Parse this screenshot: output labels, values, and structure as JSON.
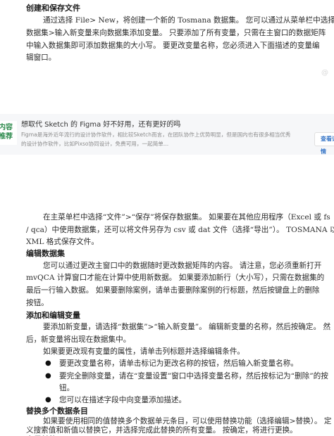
{
  "section1": {
    "heading": "创建和保存文件",
    "lines": [
      "通过选择 File> New，将创建一个新的 Tosmana 数据集。 您可以通过从菜单栏中选择",
      "数据集>输入新变量来向数据集添加变量。 只要添加了所有变量，只需在主窗口的数据矩阵",
      "中输入数据集即可添加数据集的大小写。 要更改变量名称，您必须进入下面描述的变量编",
      "辑窗口。"
    ]
  },
  "watermark": "@",
  "ad": {
    "badge_lines": [
      "内容",
      "推荐"
    ],
    "title": "想取代 Sketch 的 Figma 好不好用，还有更好的吗",
    "tag": "广告",
    "desc_lines": [
      "Figma是海外近年流行的设计协作软件，相比较Sketch而言，在团队协作上优势明显，但是国内也有很多相当优秀",
      "的设计协作软件，比如Pixso协同设计，免费可用，一起简单..."
    ],
    "button": "查看详情"
  },
  "section2": {
    "lines": [
      "在主菜单栏中选择“文件”>“保存”将保存数据集。 如果要在其他应用程序（Excel 或 fs",
      "/ qca）中使用数据集，还可以将文件另存为 csv 或 dat 文件（选择“导出”）。 TOSMANA 以",
      "XML 格式保存文件。"
    ]
  },
  "section3": {
    "heading": "编辑数据集",
    "lines": [
      "您可以通过更改主窗口中的数据随时更改数据矩阵的内容。 请注意，您必须重新打开",
      "mvQCA 计算窗口才能在计算中使用新数据。 如果要添加新行（大小写），只需在数据集的",
      "最后一行输入数据。 如果要删除案例，请单击要删除案例的行标题，然后按键盘上的删除",
      "按钮。"
    ]
  },
  "section4": {
    "heading": "添加和编辑变量",
    "lines": [
      "要添加新变量，请选择“数据集”>“输入新变量”。 编辑新变量的名称，然后按确定。 然",
      "后，新变量将出现在数据集中。",
      "如果要更改现有变量的属性，请单击列标题并选择编辑条件。"
    ],
    "bullets": [
      [
        "要更改变量名称，请单击标记为更改名称的按钮，然后输入新变量名称。"
      ],
      [
        "要完全删除变量，请在“变量设置”窗口中选择变量名称，然后按标记为“删除”的按",
        "钮。"
      ],
      [
        "您可以在描述字段中向变量添加描述。"
      ]
    ]
  },
  "section5": {
    "heading": "替换多个数据条目",
    "lines": [
      "如果要使用相同的值替换多个数据单元条目，可以使用替换功能（选择编辑>替换）。 定",
      "义搜索值和新值以替换它，并选择完成此替换的所有变量。 按确定，将进行更换。"
    ]
  },
  "section6": {
    "heading": "变量转换"
  }
}
